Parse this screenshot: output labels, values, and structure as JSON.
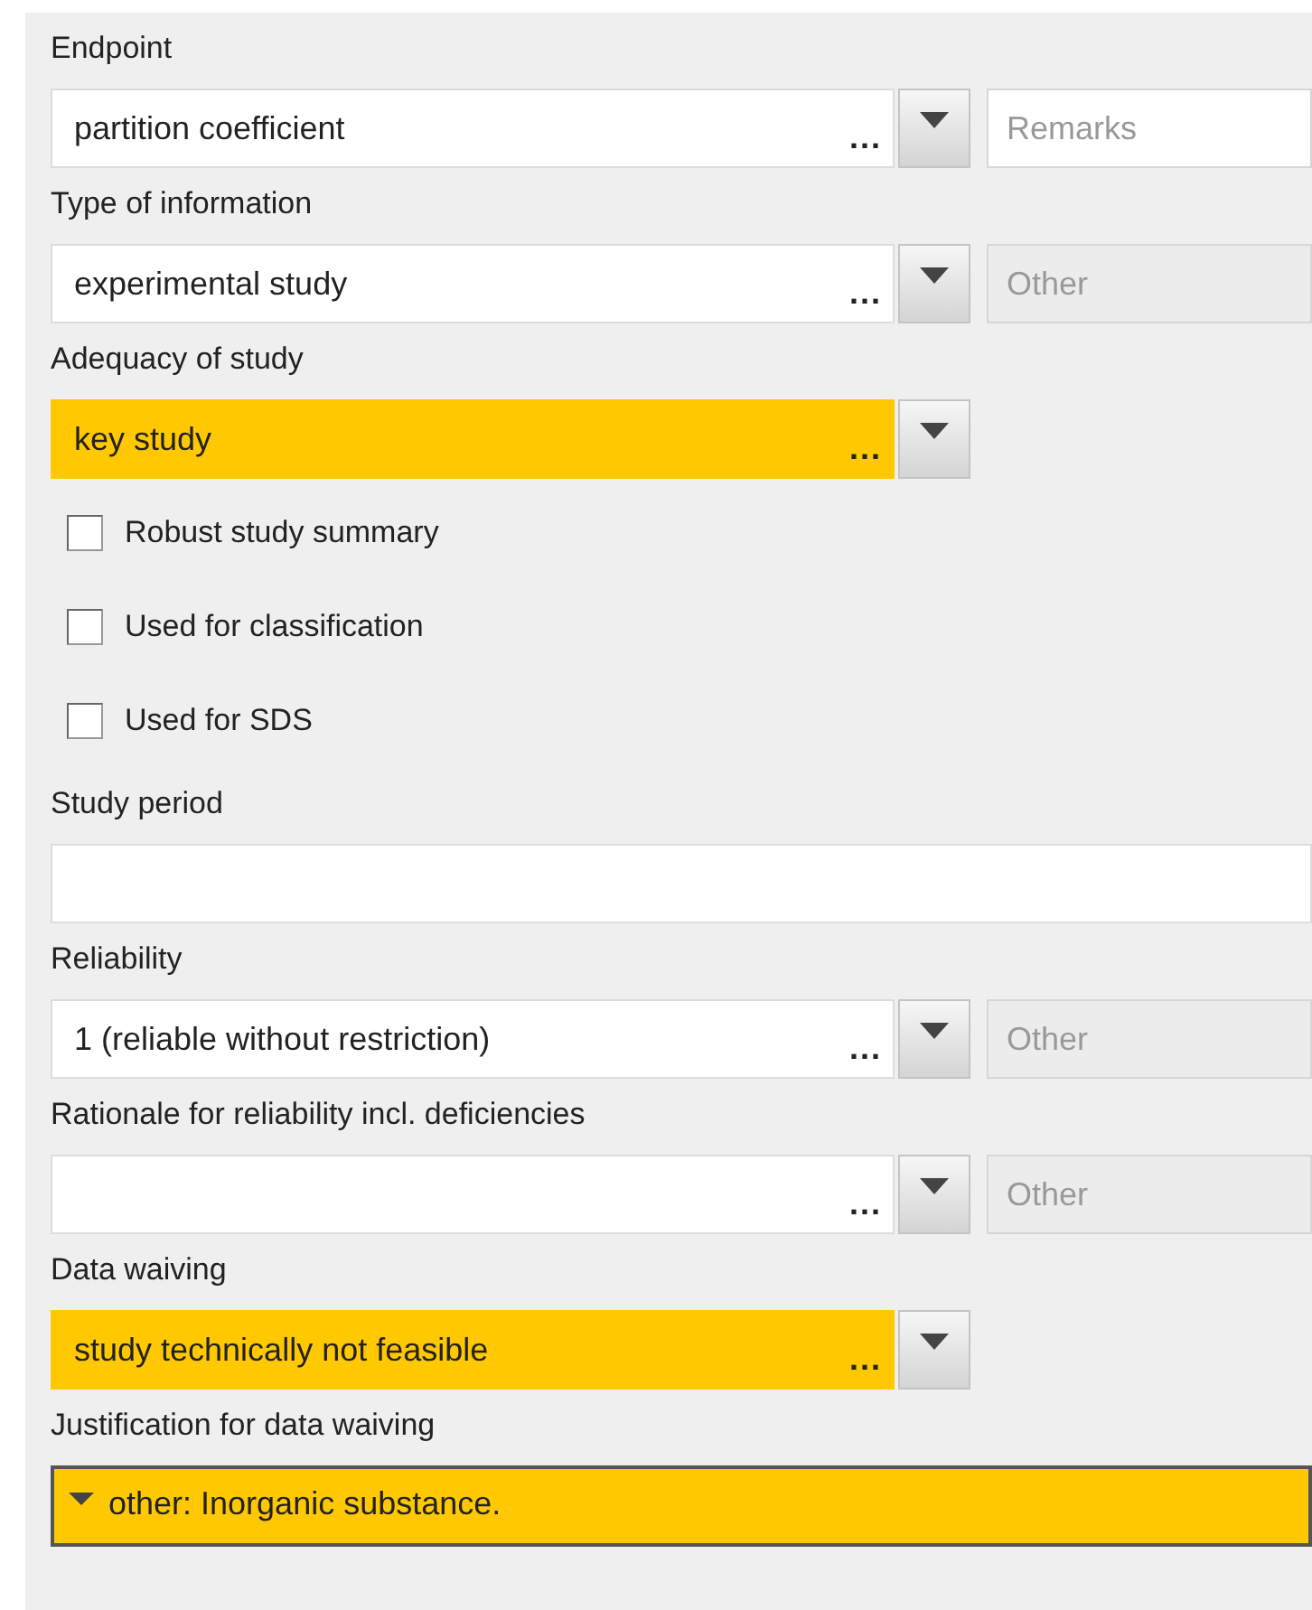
{
  "fields": [
    {
      "kind": "picklist",
      "label": "Endpoint",
      "value": "partition coefficient",
      "browse": "...",
      "highlighted": false,
      "side": {
        "placeholder": "Remarks",
        "disabled": false
      }
    },
    {
      "kind": "picklist",
      "label": "Type of information",
      "value": "experimental study",
      "browse": "...",
      "highlighted": false,
      "side": {
        "placeholder": "Other",
        "disabled": true
      }
    },
    {
      "kind": "picklist",
      "label": "Adequacy of study",
      "value": "key study",
      "browse": "...",
      "highlighted": true
    },
    {
      "kind": "checkbox",
      "label": "Robust study summary",
      "checked": false
    },
    {
      "kind": "checkbox",
      "label": "Used for classification",
      "checked": false
    },
    {
      "kind": "checkbox",
      "label": "Used for SDS",
      "checked": false
    },
    {
      "kind": "text",
      "label": "Study period"
    },
    {
      "kind": "picklist",
      "label": "Reliability",
      "value": "1 (reliable without restriction)",
      "browse": "...",
      "highlighted": false,
      "side": {
        "placeholder": "Other",
        "disabled": true
      }
    },
    {
      "kind": "picklist",
      "label": "Rationale for reliability incl. deficiencies",
      "browse": "...",
      "highlighted": false,
      "side": {
        "placeholder": "Other",
        "disabled": true
      }
    },
    {
      "kind": "picklist",
      "label": "Data waiving",
      "value": "study technically not feasible",
      "browse": "...",
      "highlighted": true
    },
    {
      "kind": "memo",
      "label": "Justification for data waiving",
      "value": "other: Inorganic substance.",
      "expanded": true,
      "highlighted": true
    }
  ]
}
